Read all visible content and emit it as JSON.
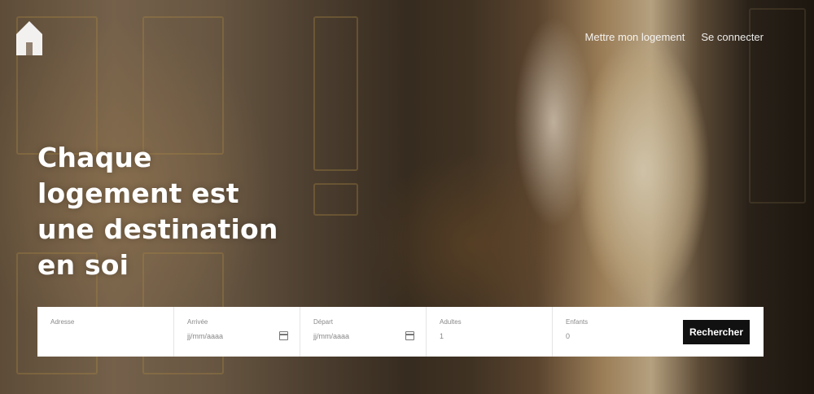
{
  "brand": {
    "logo_icon": "house-logo-icon"
  },
  "nav": {
    "items": [
      {
        "label": "Mettre mon logement"
      },
      {
        "label": "Se connecter"
      }
    ]
  },
  "hero": {
    "headline_lines": [
      "Chaque",
      "logement est",
      "une destination",
      "en soi"
    ]
  },
  "search": {
    "fields": [
      {
        "label": "Adresse",
        "value": "",
        "placeholder": ""
      },
      {
        "label": "Arrivée",
        "value": "jj/mm/aaaa",
        "icon": "calendar-icon"
      },
      {
        "label": "Départ",
        "value": "jj/mm/aaaa",
        "icon": "calendar-icon"
      },
      {
        "label": "Adultes",
        "value": "1"
      },
      {
        "label": "Enfants",
        "value": "0"
      }
    ],
    "submit_label": "Rechercher"
  }
}
